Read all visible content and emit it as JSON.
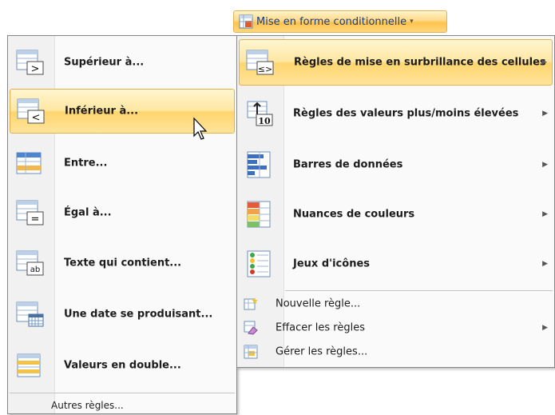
{
  "ribbon": {
    "button_label": "Mise en forme conditionnelle",
    "arrow": "▾",
    "icon": "conditional-format-icon"
  },
  "left_menu": {
    "items": [
      {
        "label": "Supérieur à...",
        "icon": "greater-than-icon"
      },
      {
        "label": "Inférieur à...",
        "icon": "less-than-icon",
        "highlighted": true
      },
      {
        "label": "Entre...",
        "icon": "between-icon"
      },
      {
        "label": "Égal à...",
        "icon": "equal-to-icon"
      },
      {
        "label": "Texte qui contient...",
        "icon": "text-contains-icon"
      },
      {
        "label": "Une date se produisant...",
        "icon": "date-occurring-icon"
      },
      {
        "label": "Valeurs en double...",
        "icon": "duplicate-values-icon"
      }
    ],
    "footer_item": "Autres règles..."
  },
  "right_menu": {
    "items": [
      {
        "label": "Règles de mise en surbrillance des cellules",
        "icon": "highlight-cells-rules-icon",
        "highlighted": true,
        "submenu": true
      },
      {
        "label": "Règles des valeurs plus/moins élevées",
        "icon": "top-bottom-rules-icon",
        "submenu": true
      },
      {
        "label": "Barres de données",
        "icon": "data-bars-icon",
        "submenu": true
      },
      {
        "label": "Nuances de couleurs",
        "icon": "color-scales-icon",
        "submenu": true
      },
      {
        "label": "Jeux d'icônes",
        "icon": "icon-sets-icon",
        "submenu": true
      }
    ],
    "small_items": [
      {
        "label": "Nouvelle règle...",
        "icon": "new-rule-icon",
        "submenu": false
      },
      {
        "label": "Effacer les règles",
        "icon": "clear-rules-icon",
        "submenu": true
      },
      {
        "label": "Gérer les règles...",
        "icon": "manage-rules-icon",
        "submenu": false
      }
    ],
    "submenu_arrow": "▶"
  },
  "colors": {
    "highlight_top": "#fff5cf",
    "highlight_bottom": "#ffd56f",
    "highlight_border": "#e0b04c",
    "menu_bg": "#fafafa",
    "menu_border": "#868686",
    "ribbon_text": "#1a3d7c"
  }
}
